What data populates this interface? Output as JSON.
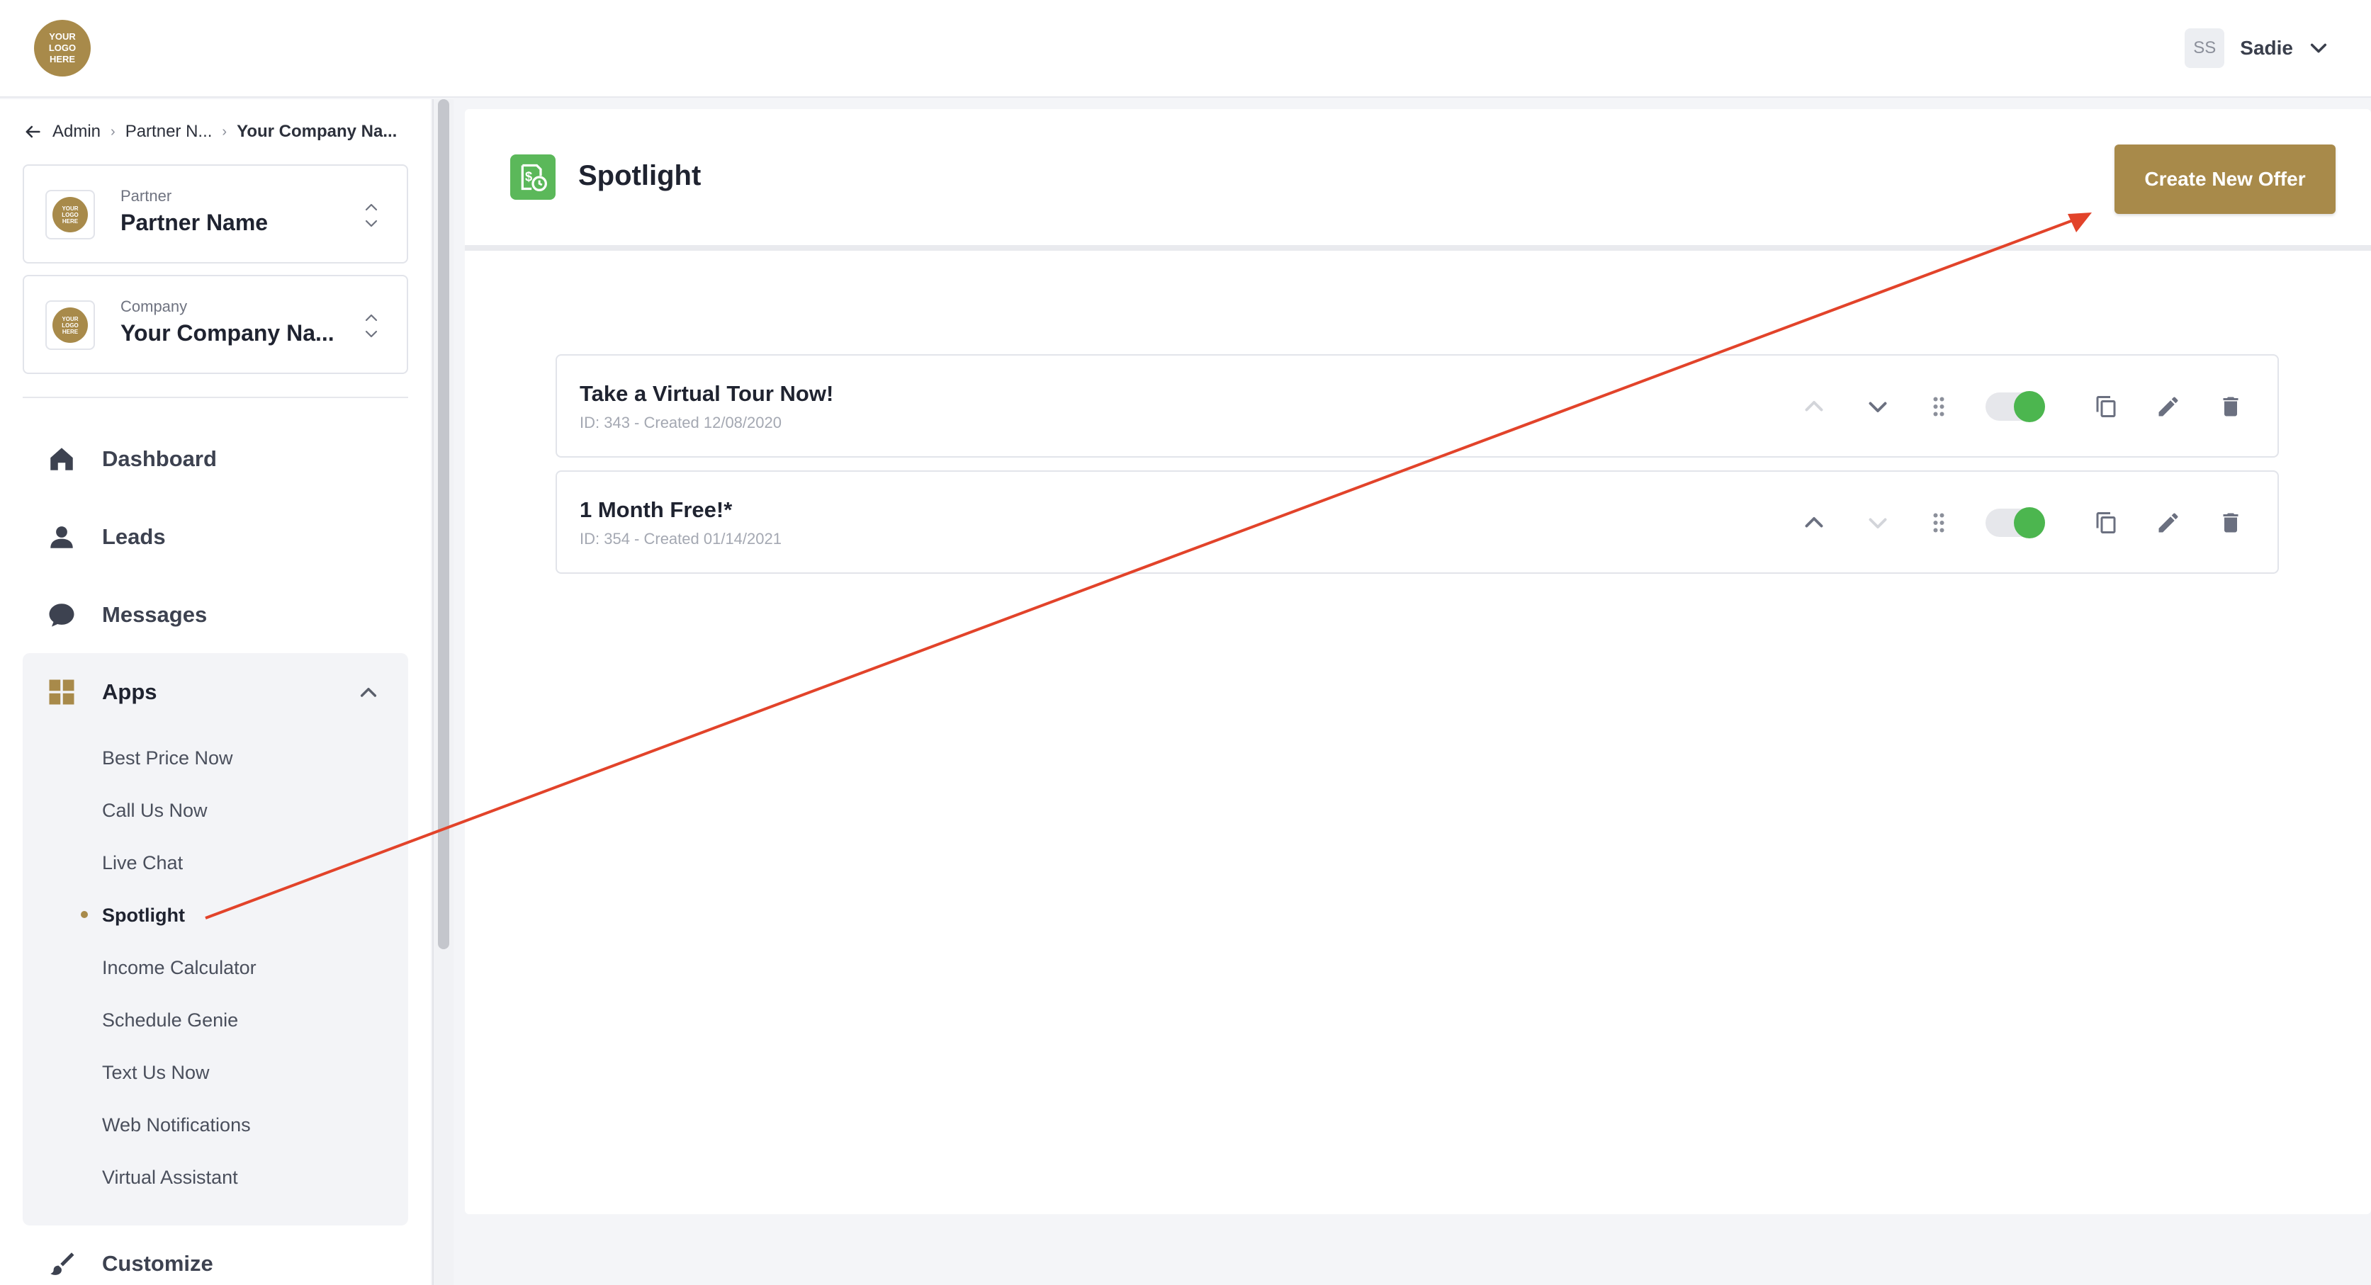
{
  "brand": {
    "logo_text": "YOUR\nLOGO\nHERE",
    "accent": "#a88a4a"
  },
  "user": {
    "initials": "SS",
    "name": "Sadie"
  },
  "breadcrumb": {
    "items": [
      "Admin",
      "Partner N...",
      "Your Company Na..."
    ]
  },
  "partner_selector": {
    "label": "Partner",
    "value": "Partner Name",
    "logo_text": "YOUR\nLOGO\nHERE"
  },
  "company_selector": {
    "label": "Company",
    "value": "Your Company Na...",
    "logo_text": "YOUR\nLOGO\nHERE"
  },
  "nav": {
    "dashboard": "Dashboard",
    "leads": "Leads",
    "messages": "Messages",
    "apps": "Apps",
    "customize": "Customize",
    "app_items": [
      "Best Price Now",
      "Call Us Now",
      "Live Chat",
      "Spotlight",
      "Income Calculator",
      "Schedule Genie",
      "Text Us Now",
      "Web Notifications",
      "Virtual Assistant"
    ],
    "active_app": "Spotlight"
  },
  "page": {
    "title": "Spotlight",
    "create_button": "Create New Offer"
  },
  "offers": [
    {
      "title": "Take a Virtual Tour Now!",
      "meta": "ID: 343 - Created 12/08/2020",
      "enabled": true
    },
    {
      "title": "1 Month Free!*",
      "meta": "ID: 354 - Created 01/14/2021",
      "enabled": true
    }
  ],
  "colors": {
    "toggle_on": "#4cb64f",
    "annotation_arrow": "#e2432a",
    "page_icon": "#5bb85a"
  }
}
